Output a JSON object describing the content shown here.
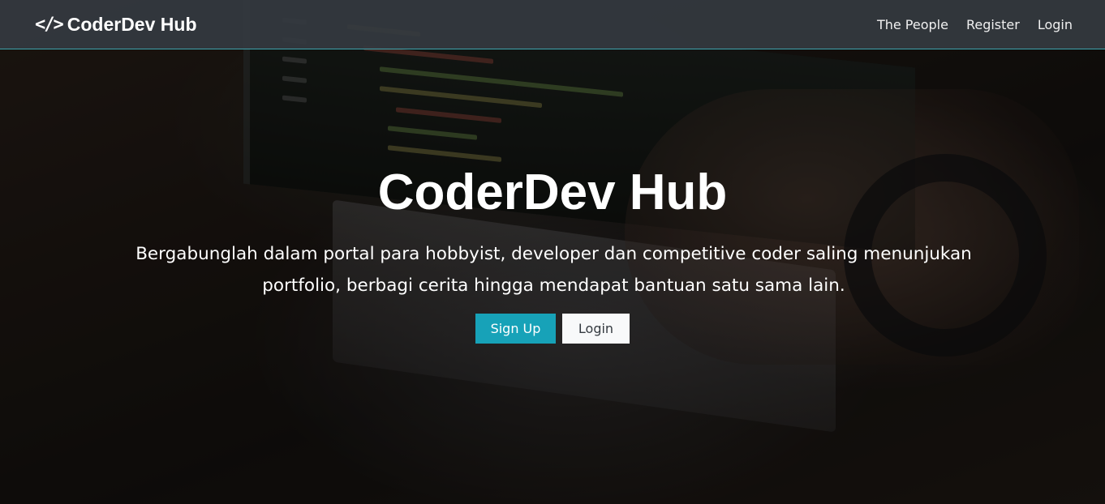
{
  "navbar": {
    "brand_icon": "</>",
    "brand": "CoderDev Hub",
    "links": [
      "The People",
      "Register",
      "Login"
    ]
  },
  "hero": {
    "title": "CoderDev Hub",
    "lead": "Bergabunglah dalam portal para hobbyist, developer dan competitive coder saling menunjukan portfolio, berbagi cerita hingga mendapat bantuan satu sama lain.",
    "signup_label": "Sign Up",
    "login_label": "Login"
  },
  "colors": {
    "navbar_bg": "#343a40",
    "navbar_border": "#3fa6b0",
    "primary": "#17a2b8",
    "light": "#f8f9fa"
  },
  "icons": [
    "code-icon"
  ]
}
